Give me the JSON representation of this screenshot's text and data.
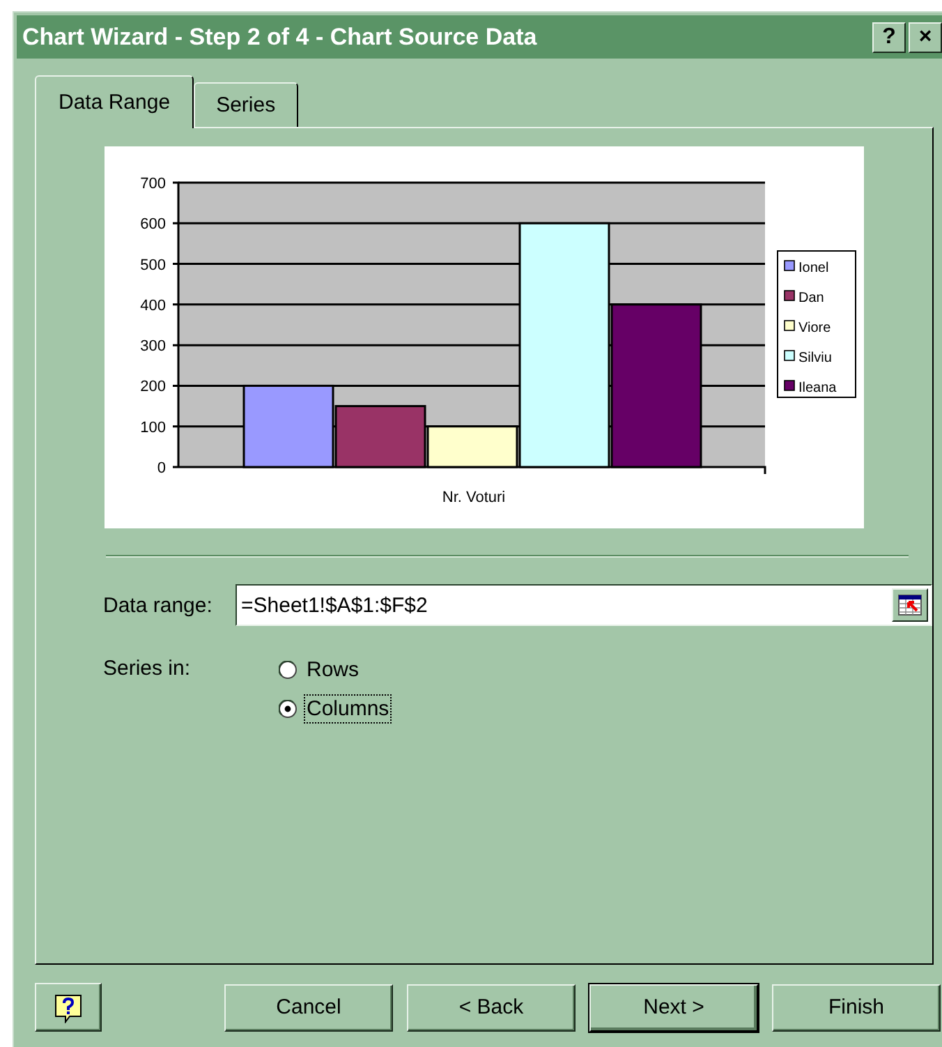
{
  "window": {
    "title": "Chart Wizard - Step 2 of 4 - Chart Source Data",
    "title_buttons": [
      "?",
      "×"
    ]
  },
  "tabs": [
    {
      "label": "Data Range",
      "selected": true
    },
    {
      "label": "Series",
      "selected": false
    }
  ],
  "preview": {
    "chart_data": {
      "type": "bar",
      "grid": true,
      "legend": "right",
      "categories": [
        "Nr. Voturi"
      ],
      "ylim": [
        0,
        700
      ],
      "yticks": [
        0,
        100,
        200,
        300,
        400,
        500,
        600,
        700
      ],
      "series": [
        {
          "name": "Ionel",
          "color": "#9999ff",
          "values": [
            200
          ]
        },
        {
          "name": "Dan",
          "color": "#993366",
          "values": [
            150
          ]
        },
        {
          "name": "Viore",
          "color": "#ffffcc",
          "values": [
            100
          ]
        },
        {
          "name": "Silviu",
          "color": "#ccffff",
          "values": [
            600
          ]
        },
        {
          "name": "Ileana",
          "color": "#660066",
          "values": [
            400
          ]
        }
      ]
    }
  },
  "data_range": {
    "label": "Data range:",
    "value": "=Sheet1!$A$1:$F$2"
  },
  "series_in": {
    "label": "Series in:",
    "options": [
      {
        "label": "Rows",
        "selected": false
      },
      {
        "label": "Columns",
        "selected": true
      }
    ]
  },
  "buttons": [
    {
      "label": "Cancel",
      "default": false
    },
    {
      "label": "< Back",
      "default": false
    },
    {
      "label": "Next >",
      "default": true
    },
    {
      "label": "Finish",
      "default": false
    }
  ]
}
